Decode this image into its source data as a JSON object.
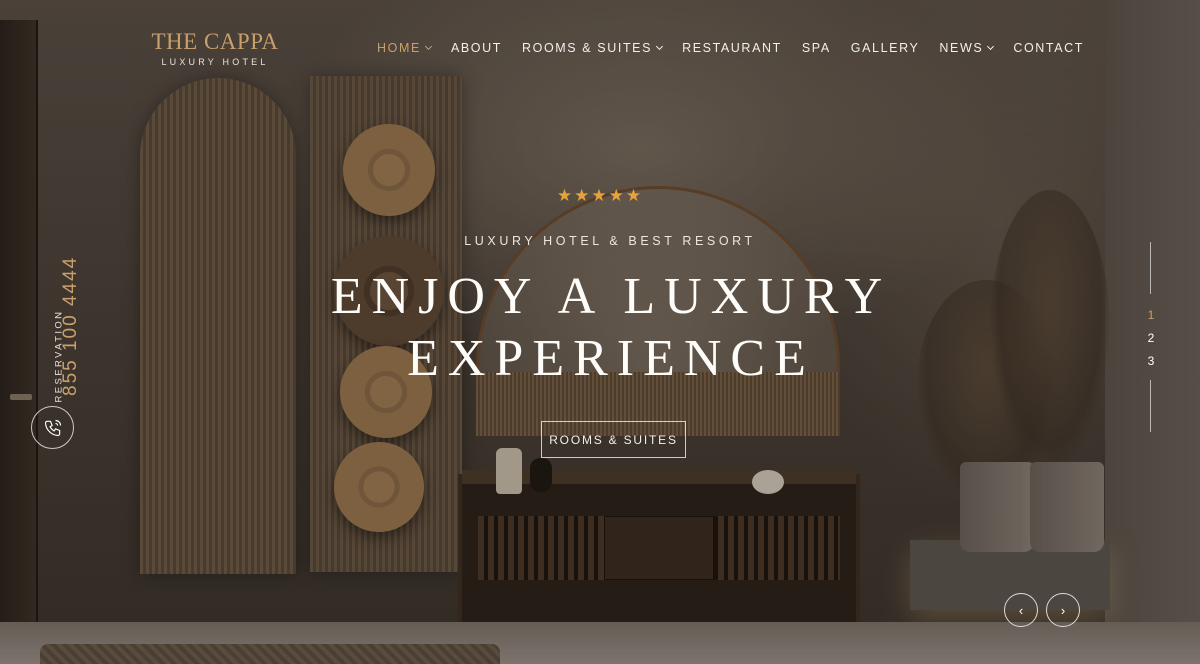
{
  "logo": {
    "title": "THE CAPPA",
    "subtitle": "LUXURY HOTEL"
  },
  "nav": [
    {
      "label": "HOME",
      "dropdown": true,
      "active": true
    },
    {
      "label": "ABOUT",
      "dropdown": false,
      "active": false
    },
    {
      "label": "ROOMS & SUITES",
      "dropdown": true,
      "active": false
    },
    {
      "label": "RESTAURANT",
      "dropdown": false,
      "active": false
    },
    {
      "label": "SPA",
      "dropdown": false,
      "active": false
    },
    {
      "label": "GALLERY",
      "dropdown": false,
      "active": false
    },
    {
      "label": "NEWS",
      "dropdown": true,
      "active": false
    },
    {
      "label": "CONTACT",
      "dropdown": false,
      "active": false
    }
  ],
  "hero": {
    "rating": 5,
    "stars": "★★★★★",
    "tagline": "LUXURY HOTEL & BEST RESORT",
    "title_line1": "ENJOY A LUXURY",
    "title_line2": "EXPERIENCE",
    "button_label": "ROOMS & SUITES"
  },
  "reservation": {
    "label": "RESERVATION",
    "phone": "855 100 4444",
    "icon": "phone-icon"
  },
  "slider": {
    "slides": [
      "1",
      "2",
      "3"
    ],
    "active_index": 0,
    "prev_icon": "chevron-left-icon",
    "next_icon": "chevron-right-icon",
    "prev_glyph": "‹",
    "next_glyph": "›"
  },
  "colors": {
    "accent": "#c9a06b",
    "star": "#e8a23c",
    "text": "#ffffff"
  }
}
